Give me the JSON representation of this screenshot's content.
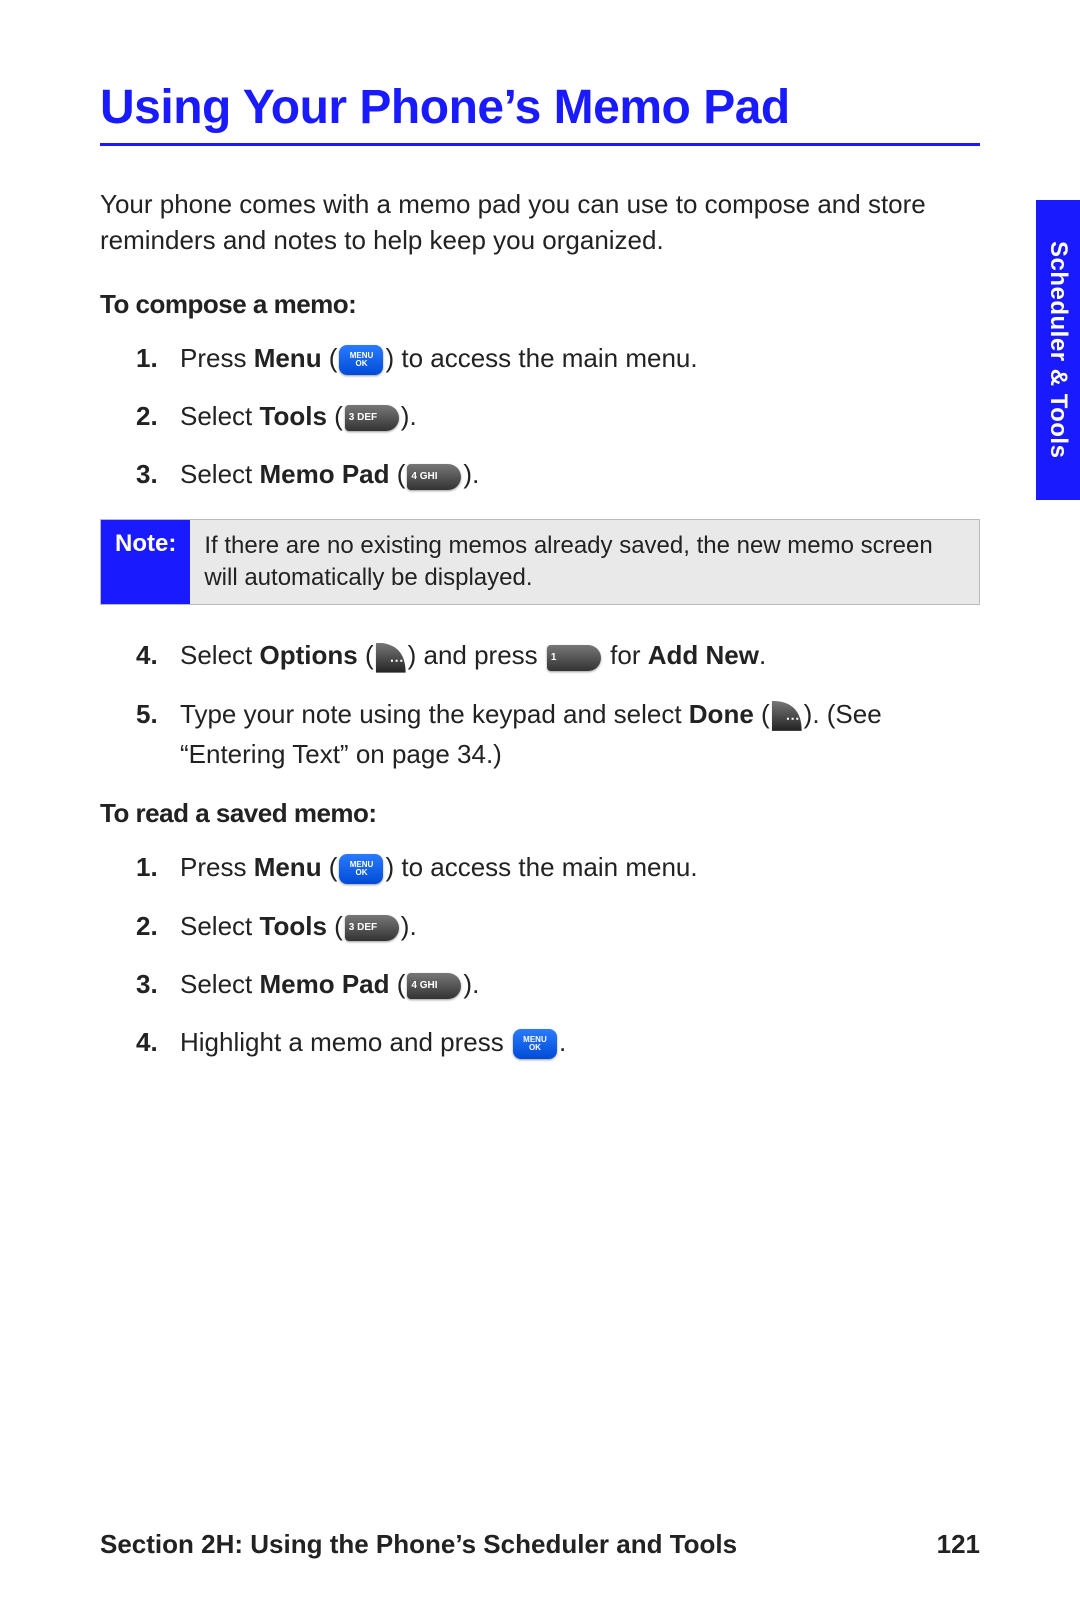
{
  "title": "Using Your Phone’s Memo Pad",
  "intro": "Your phone comes with a memo pad you can use to compose and store reminders and notes to help keep you organized.",
  "side_tab": "Scheduler & Tools",
  "compose": {
    "heading": "To compose a memo:",
    "step1_a": "Press ",
    "step1_bold": "Menu",
    "step1_b": " (",
    "step1_c": ") to access the main menu.",
    "step2_a": "Select ",
    "step2_bold": "Tools",
    "step2_b": " (",
    "step2_c": ").",
    "step3_a": "Select ",
    "step3_bold": "Memo Pad",
    "step3_b": " (",
    "step3_c": ").",
    "note_label": "Note:",
    "note_text": "If there are no existing memos already saved, the new memo screen will automatically be displayed.",
    "step4_a": "Select ",
    "step4_bold1": "Options",
    "step4_b": " (",
    "step4_c": ") and press ",
    "step4_d": " for ",
    "step4_bold2": "Add New",
    "step4_e": ".",
    "step5_a": "Type your note using the keypad and select ",
    "step5_bold": "Done",
    "step5_b": " (",
    "step5_c": "). (See “Entering Text” on page 34.)"
  },
  "read": {
    "heading": "To read a saved memo:",
    "step1_a": "Press ",
    "step1_bold": "Menu",
    "step1_b": " (",
    "step1_c": ") to access the main menu.",
    "step2_a": "Select ",
    "step2_bold": "Tools",
    "step2_b": " (",
    "step2_c": ").",
    "step3_a": "Select ",
    "step3_bold": "Memo Pad",
    "step3_b": " (",
    "step3_c": ").",
    "step4_a": "Highlight a memo and press ",
    "step4_b": "."
  },
  "key_labels": {
    "menu": "MENU",
    "ok": "OK",
    "key3": "3 DEF",
    "key4": "4 GHI",
    "key1": "1"
  },
  "footer": {
    "left": "Section 2H: Using the Phone’s Scheduler and Tools",
    "right": "121"
  }
}
